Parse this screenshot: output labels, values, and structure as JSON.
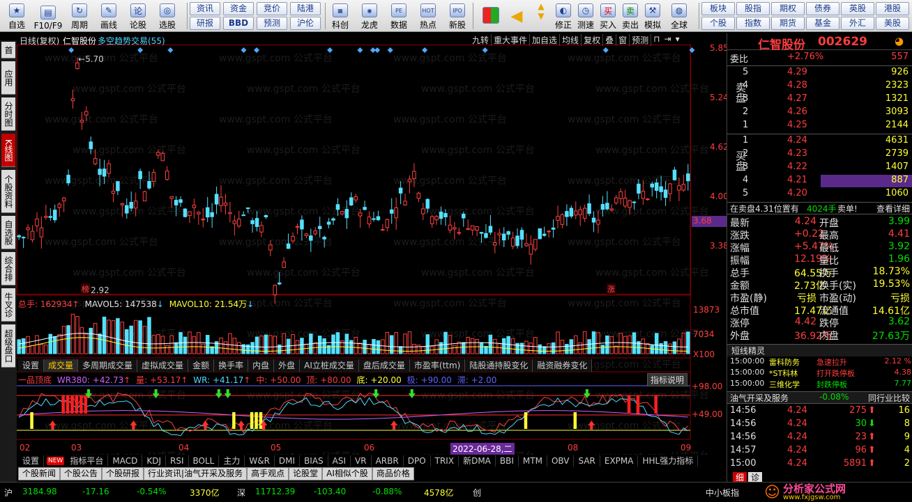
{
  "toolbar": {
    "left": [
      {
        "label": "自选",
        "icon": "star-icon",
        "glyph": "★"
      },
      {
        "label": "F10/F9",
        "icon": "f10-icon",
        "glyph": "▤"
      },
      {
        "label": "周期",
        "icon": "period-icon",
        "glyph": "↻"
      },
      {
        "label": "画线",
        "icon": "draw-line-icon",
        "glyph": "✎"
      },
      {
        "label": "论股",
        "icon": "forum-icon",
        "glyph": "论"
      },
      {
        "label": "选股",
        "icon": "stock-pick-icon",
        "glyph": "◎"
      }
    ],
    "grid": [
      [
        "资讯",
        "资金",
        "竞价",
        "陆港"
      ],
      [
        "研报",
        "BBD",
        "预测",
        "沪伦"
      ]
    ],
    "mid": [
      {
        "label": "科创",
        "icon": "kechuang-icon",
        "glyph": "▦"
      },
      {
        "label": "龙虎",
        "icon": "longhu-icon",
        "glyph": "◉"
      },
      {
        "label": "数据",
        "icon": "data-icon",
        "glyph": "PE"
      },
      {
        "label": "热点",
        "icon": "hot-icon",
        "glyph": "HOT"
      },
      {
        "label": "新股",
        "icon": "ipo-icon",
        "glyph": "IPO"
      }
    ],
    "right": [
      {
        "label": "修正",
        "icon": "fix-icon",
        "glyph": "◐"
      },
      {
        "label": "测速",
        "icon": "speed-icon",
        "glyph": "◷"
      },
      {
        "label": "买入",
        "icon": "buy-icon",
        "glyph": "买"
      },
      {
        "label": "卖出",
        "icon": "sell-icon",
        "glyph": "卖"
      },
      {
        "label": "模拟",
        "icon": "sim-icon",
        "glyph": "⚒"
      },
      {
        "label": "全球",
        "icon": "globe-icon",
        "glyph": "◍"
      }
    ],
    "grid2": [
      [
        "板块",
        "股指",
        "期权",
        "债券",
        "英股",
        "港股"
      ],
      [
        "个股",
        "指数",
        "期货",
        "基金",
        "外汇",
        "美股"
      ]
    ]
  },
  "sidebar": [
    "首页",
    "应用",
    "分时图",
    "K线图",
    "个股资料",
    "自选股",
    "综合排名",
    "牛叉诊股",
    "超级盘口"
  ],
  "chart": {
    "header": [
      "日线(复权)",
      "仁智股份",
      "多空趋势交易(55)"
    ],
    "topbar": [
      "九转",
      "重大事件",
      "加自选",
      "均线",
      "复权",
      "叠",
      "窗",
      "预测"
    ],
    "price_ticks": [
      "5.85",
      "5.24",
      "4.62",
      "4.00",
      "3.38"
    ],
    "current_price": "3.68",
    "high_label": "5.70",
    "low_label": "2.92",
    "marker_bang": "榜",
    "marker_zhang": "涨",
    "vol_header": {
      "total": "总手: 162934",
      "ma5": "MAVOL5: 147538",
      "ma10": "MAVOL10: 21.54万"
    },
    "vol_ticks": [
      "13873",
      "7034",
      "X100"
    ],
    "ind_tabs": [
      "设置",
      "成交量",
      "多周期成交量",
      "虚拟成交量",
      "金额",
      "换手率",
      "内盘",
      "外盘",
      "AI立桩成交量",
      "盘后成交量",
      "市盈率(ttm)",
      "陆股通持股变化",
      "融资融券变化"
    ],
    "ind_header": {
      "name": "一品顶底",
      "wr380": "WR380: +42.73",
      "liang": "量: +53.17",
      "wr": "WR: +41.17",
      "zhong": "中: +50.00",
      "ding": "顶: +80.00",
      "di": "底: +20.00",
      "ji": "极: +90.00",
      "zhi": "滞: +2.00"
    },
    "ind_help": "指标说明",
    "ind_ticks": [
      "98.00",
      "49.00"
    ],
    "dates": [
      "02",
      "03",
      "04",
      "05",
      "06",
      "07",
      "08",
      "09"
    ],
    "date_cursor": "2022-06-28,二"
  },
  "bottom_tabs": [
    "设置",
    "指标平台",
    "MACD",
    "KDJ",
    "RSI",
    "BOLL",
    "主力",
    "W&R",
    "DMI",
    "BIAS",
    "ASI",
    "VR",
    "ARBR",
    "DPO",
    "TRIX",
    "新DMA",
    "BBI",
    "MTM",
    "OBV",
    "SAR",
    "EXPMA",
    "HHL强力指标"
  ],
  "new_badge": "NEW",
  "news_tabs": [
    "个股新闻",
    "个股公告",
    "个股研报",
    "行业资讯|油气开采及服务",
    "高手观点",
    "论股堂",
    "AI相似个股",
    "商品价格"
  ],
  "quote": {
    "title": "仁智股份",
    "code": "002629",
    "weibi": "委比",
    "weibi_val": "+2.76%",
    "weicha": "557",
    "sell_label": "卖盘",
    "buy_label": "买盘",
    "asks": [
      [
        "5",
        "4.29",
        "926"
      ],
      [
        "4",
        "4.28",
        "2323"
      ],
      [
        "3",
        "4.27",
        "1321"
      ],
      [
        "2",
        "4.26",
        "3093"
      ],
      [
        "1",
        "4.25",
        "2144"
      ]
    ],
    "bids": [
      [
        "1",
        "4.24",
        "4631"
      ],
      [
        "2",
        "4.23",
        "2739"
      ],
      [
        "3",
        "4.22",
        "1407"
      ],
      [
        "4",
        "4.21",
        "887"
      ],
      [
        "5",
        "4.20",
        "1060"
      ]
    ],
    "notice": "在卖盘4.31位置有",
    "notice_vol": "4024手",
    "notice_act": "卖单!",
    "notice_link": "查看详细",
    "stats": [
      [
        "最新",
        "4.24",
        "开盘",
        "3.99"
      ],
      [
        "涨跌",
        "+0.22",
        "最高",
        "4.41"
      ],
      [
        "涨幅",
        "+5.47%",
        "最低",
        "3.92"
      ],
      [
        "振幅",
        "12.19%",
        "量比",
        "1.96"
      ],
      [
        "总手",
        "64.55万",
        "换手",
        "18.73%"
      ],
      [
        "金额",
        "2.73亿",
        "换手(实)",
        "19.53%"
      ],
      [
        "市盈(静)",
        "亏损",
        "市盈(动)",
        "亏损"
      ],
      [
        "总市值",
        "17.47亿",
        "流通值",
        "14.61亿"
      ],
      [
        "涨停",
        "4.42",
        "跌停",
        "3.62"
      ],
      [
        "外盘",
        "36.92万",
        "内盘",
        "27.63万"
      ]
    ],
    "short_title": "短线精灵",
    "short": [
      [
        "15:00:00",
        "雷科防务",
        "急速拉升",
        "2.12 %"
      ],
      [
        "15:00:00",
        "*ST科林",
        "打开跌停板",
        "4.38"
      ],
      [
        "15:00:00",
        "三维化学",
        "封跌停板",
        "7.77"
      ]
    ],
    "sector": "油气开采及服务",
    "sector_chg": "-0.08%",
    "sector_btn": "同行业比较",
    "ticks": [
      [
        "14:56",
        "4.24",
        "275",
        "16"
      ],
      [
        "14:56",
        "4.24",
        "30",
        "8"
      ],
      [
        "14:56",
        "4.24",
        "23",
        "9"
      ],
      [
        "14:57",
        "4.24",
        "96",
        "4"
      ],
      [
        "15:00",
        "4.24",
        "5891",
        "2"
      ]
    ],
    "side_tabs": [
      "细",
      "诊"
    ],
    "board": "中小板指"
  },
  "status": {
    "sh": "沪",
    "sh_val": "3184.98",
    "sh_chg": "-17.16",
    "sh_pct": "-0.54%",
    "sh_amt": "3370亿",
    "sz": "深",
    "sz_val": "11712.39",
    "sz_chg": "-103.40",
    "sz_pct": "-0.88%",
    "sz_amt": "4578亿",
    "chuang": "创"
  },
  "watermark": "www.gspt.com 公式平台",
  "logo": {
    "name": "分析家公式网",
    "url": "www.fxjgsw.com"
  }
}
